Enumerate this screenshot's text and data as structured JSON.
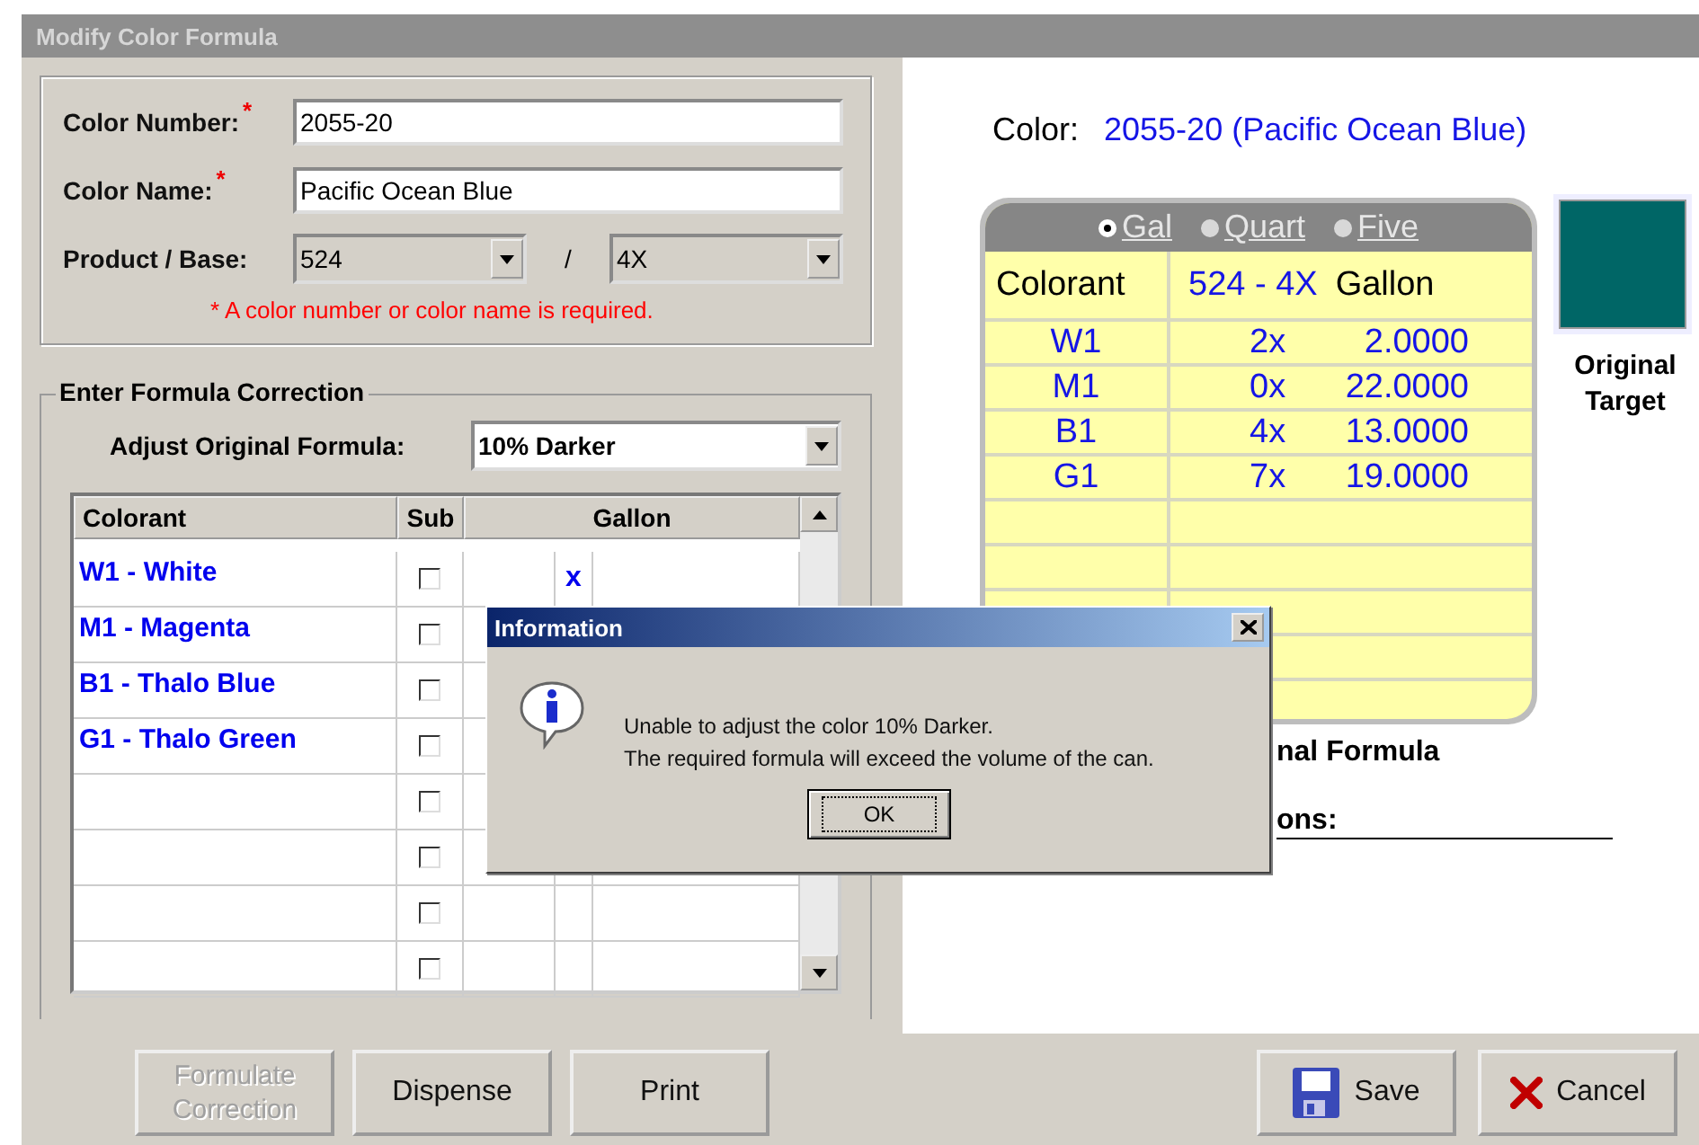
{
  "window": {
    "title": "Modify Color Formula"
  },
  "color_fields": [
    {
      "label": "Color Number:",
      "required": true,
      "value": "2055-20"
    },
    {
      "label": "Color Name:",
      "required": true,
      "value": "Pacific Ocean Blue"
    }
  ],
  "required_mark": "*",
  "product_base": {
    "label": "Product / Base:",
    "product": "524",
    "separator": "/",
    "base": "4X"
  },
  "required_note": "* A color number or color name is required.",
  "correction": {
    "title": "Enter Formula Correction",
    "adjust_label": "Adjust Original Formula:",
    "adjust_value": "10% Darker",
    "columns": [
      "Colorant",
      "Sub",
      "Gallon"
    ],
    "rows": [
      {
        "colorant": "W1 - White",
        "sub": false,
        "mark": "x"
      },
      {
        "colorant": "M1 - Magenta",
        "sub": false
      },
      {
        "colorant": "B1 - Thalo Blue",
        "sub": false
      },
      {
        "colorant": "G1 - Thalo Green",
        "sub": false
      },
      {
        "sub": false
      },
      {
        "sub": false
      },
      {
        "sub": false
      },
      {
        "sub": false
      }
    ]
  },
  "color_heading": {
    "label": "Color:",
    "value": "2055-20 (Pacific Ocean Blue)"
  },
  "formula": {
    "units": [
      {
        "label": "Gal",
        "selected": true
      },
      {
        "label": "Quart",
        "selected": false
      },
      {
        "label": "Five",
        "selected": false
      }
    ],
    "column_1": "Colorant",
    "column_2": {
      "product": "524 - 4X",
      "unit": "Gallon"
    },
    "rows": [
      {
        "colorant": "W1",
        "shots": "2x",
        "amount": "2.0000"
      },
      {
        "colorant": "M1",
        "shots": "0x",
        "amount": "22.0000"
      },
      {
        "colorant": "B1",
        "shots": "4x",
        "amount": "13.0000"
      },
      {
        "colorant": "G1",
        "shots": "7x",
        "amount": "19.0000"
      }
    ]
  },
  "target": {
    "label": "Original Target"
  },
  "formula_caption": "nal Formula",
  "instructions_label": "ons:",
  "left_buttons": [
    {
      "label": "Formulate Correction",
      "disabled": true
    },
    {
      "label": "Dispense",
      "disabled": false
    },
    {
      "label": "Print",
      "disabled": false
    }
  ],
  "right_buttons": [
    {
      "label": "Save",
      "kind": "save"
    },
    {
      "label": "Cancel",
      "kind": "cancel"
    }
  ],
  "dialog": {
    "title": "Information",
    "lines": [
      "Unable to adjust the color 10% Darker.",
      "The required formula will exceed the volume of the can."
    ],
    "button": "OK"
  }
}
